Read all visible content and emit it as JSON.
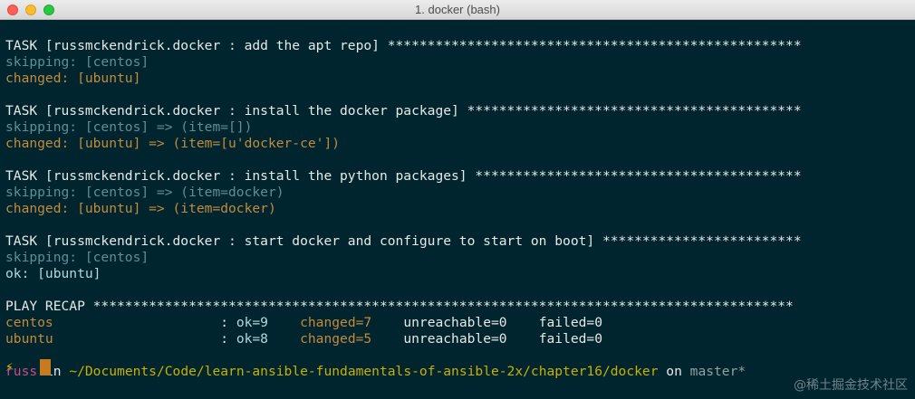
{
  "window": {
    "title": "1. docker (bash)"
  },
  "terminal": {
    "lines": [
      {
        "segments": [
          {
            "text": "TASK [russmckendrick.docker : add the apt repo] ****************************************************",
            "color": "white"
          }
        ]
      },
      {
        "segments": [
          {
            "text": "skipping: [centos]",
            "color": "teal"
          }
        ]
      },
      {
        "segments": [
          {
            "text": "changed: [ubuntu]",
            "color": "orange"
          }
        ]
      },
      {
        "segments": [
          {
            "text": "",
            "color": "white"
          }
        ]
      },
      {
        "segments": [
          {
            "text": "TASK [russmckendrick.docker : install the docker package] ******************************************",
            "color": "white"
          }
        ]
      },
      {
        "segments": [
          {
            "text": "skipping: [centos] => (item=[])",
            "color": "teal"
          }
        ]
      },
      {
        "segments": [
          {
            "text": "changed: [ubuntu] => (item=[u'docker-ce'])",
            "color": "orange"
          }
        ]
      },
      {
        "segments": [
          {
            "text": "",
            "color": "white"
          }
        ]
      },
      {
        "segments": [
          {
            "text": "TASK [russmckendrick.docker : install the python packages] *****************************************",
            "color": "white"
          }
        ]
      },
      {
        "segments": [
          {
            "text": "skipping: [centos] => (item=docker)",
            "color": "teal"
          }
        ]
      },
      {
        "segments": [
          {
            "text": "changed: [ubuntu] => (item=docker)",
            "color": "orange"
          }
        ]
      },
      {
        "segments": [
          {
            "text": "",
            "color": "white"
          }
        ]
      },
      {
        "segments": [
          {
            "text": "TASK [russmckendrick.docker : start docker and configure to start on boot] *************************",
            "color": "white"
          }
        ]
      },
      {
        "segments": [
          {
            "text": "skipping: [centos]",
            "color": "teal"
          }
        ]
      },
      {
        "segments": [
          {
            "text": "ok: [ubuntu]",
            "color": "ok"
          }
        ]
      },
      {
        "segments": [
          {
            "text": "",
            "color": "white"
          }
        ]
      },
      {
        "segments": [
          {
            "text": "PLAY RECAP ****************************************************************************************",
            "color": "white"
          }
        ]
      },
      {
        "segments": [
          {
            "text": "centos                     ",
            "color": "orange"
          },
          {
            "text": ": ",
            "color": "white"
          },
          {
            "text": "ok=9    ",
            "color": "ok"
          },
          {
            "text": "changed=7    ",
            "color": "orange"
          },
          {
            "text": "unreachable=0    ",
            "color": "white"
          },
          {
            "text": "failed=0",
            "color": "white"
          }
        ]
      },
      {
        "segments": [
          {
            "text": "ubuntu                     ",
            "color": "orange"
          },
          {
            "text": ": ",
            "color": "white"
          },
          {
            "text": "ok=8    ",
            "color": "ok"
          },
          {
            "text": "changed=5    ",
            "color": "orange"
          },
          {
            "text": "unreachable=0    ",
            "color": "white"
          },
          {
            "text": "failed=0",
            "color": "white"
          }
        ]
      },
      {
        "segments": [
          {
            "text": "",
            "color": "white"
          }
        ]
      },
      {
        "segments": [
          {
            "text": "russ",
            "color": "user"
          },
          {
            "text": " in ",
            "color": "white"
          },
          {
            "text": "~/Documents/Code/learn-ansible-fundamentals-of-ansible-2x/chapter16/docker",
            "color": "yellow"
          },
          {
            "text": " on ",
            "color": "white"
          },
          {
            "text": "master*",
            "color": "gray"
          }
        ]
      }
    ],
    "prompt_symbol": "⚡",
    "watermark": "@稀土掘金技术社区"
  },
  "colors": {
    "background": "#00252e",
    "white": "#e8e8e8",
    "teal": "#5f8f97",
    "orange": "#c58a3c",
    "ok": "#b6d7db",
    "user": "#cf4a82",
    "yellow": "#c9b000",
    "gray": "#93a1a1"
  }
}
